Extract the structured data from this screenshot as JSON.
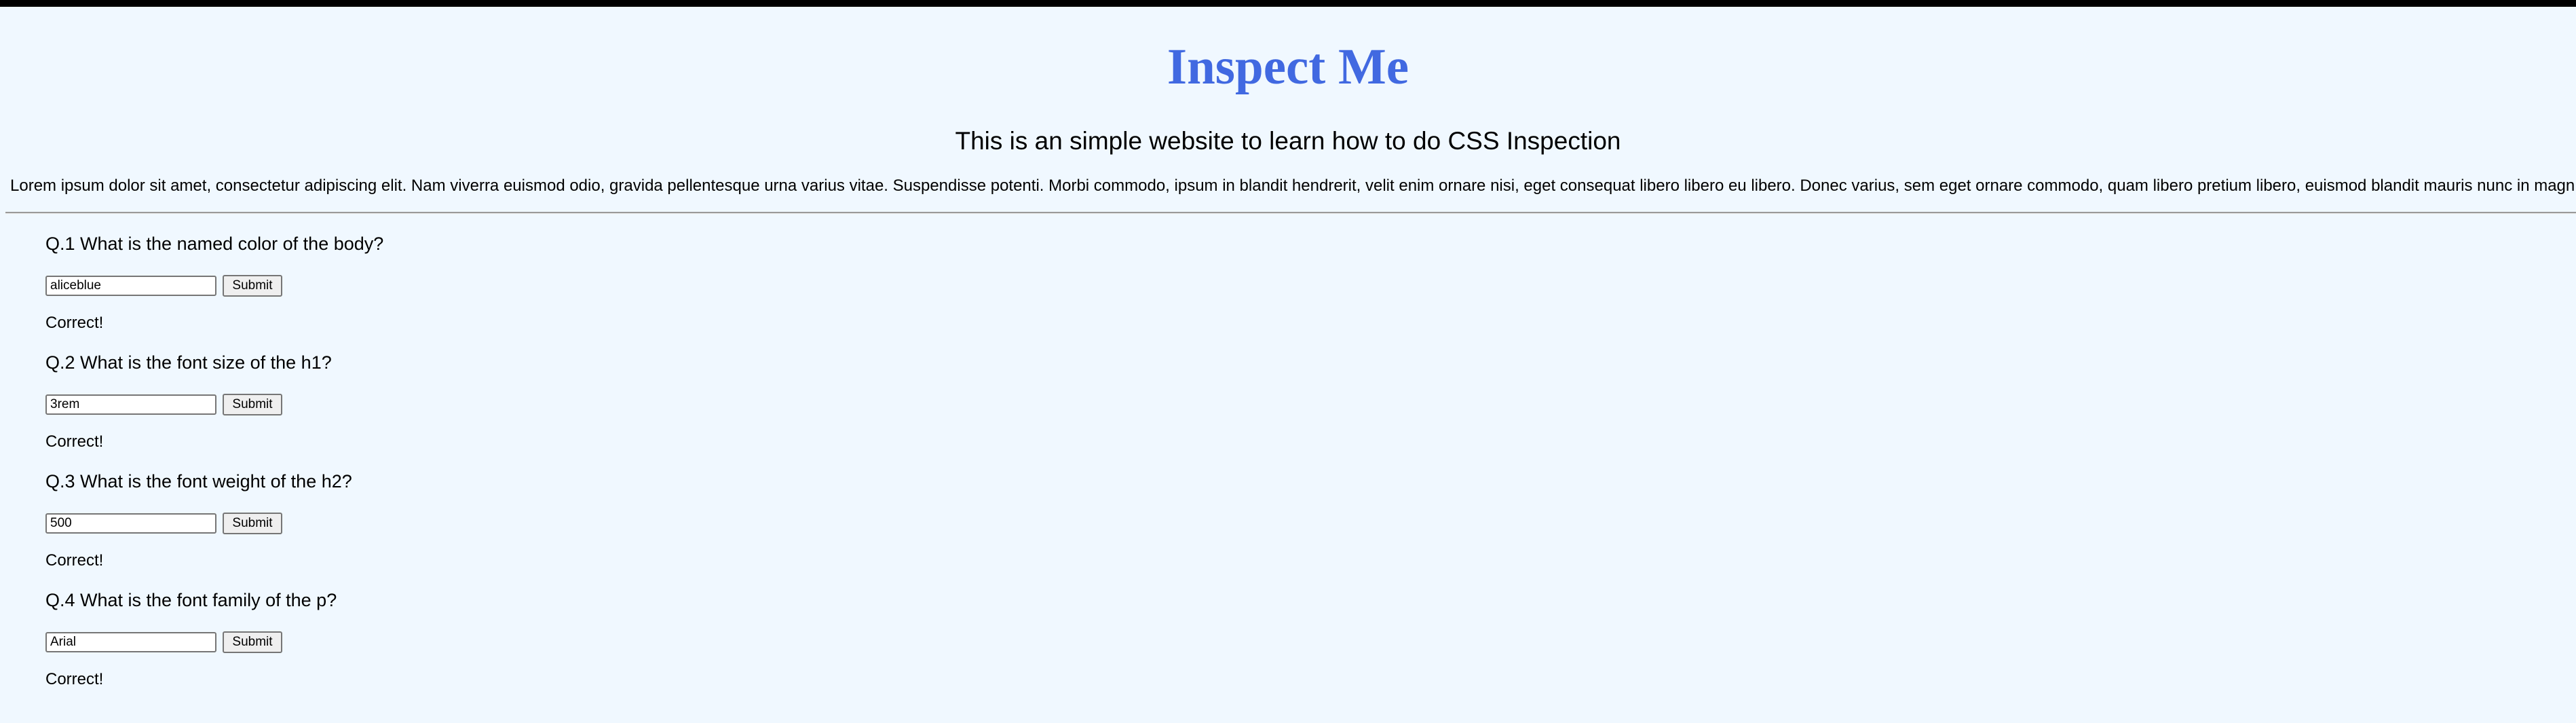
{
  "page": {
    "title": "Inspect Me",
    "subtitle": "This is an simple website to learn how to do CSS Inspection",
    "intro": "Lorem ipsum dolor sit amet, consectetur adipiscing elit. Nam viverra euismod odio, gravida pellentesque urna varius vitae. Suspendisse potenti. Morbi commodo, ipsum in blandit hendrerit, velit enim ornare nisi, eget consequat libero libero eu libero. Donec varius, sem eget ornare commodo, quam libero pretium libero, euismod blandit mauris nunc in magn"
  },
  "quiz": {
    "submit_label": "Submit",
    "questions": [
      {
        "question": "Q.1 What is the named color of the body?",
        "answer": "aliceblue",
        "result": "Correct!"
      },
      {
        "question": "Q.2 What is the font size of the h1?",
        "answer": "3rem",
        "result": "Correct!"
      },
      {
        "question": "Q.3 What is the font weight of the h2?",
        "answer": "500",
        "result": "Correct!"
      },
      {
        "question": "Q.4 What is the font family of the p?",
        "answer": "Arial",
        "result": "Correct!"
      }
    ]
  },
  "colors": {
    "background": "#f0f8ff",
    "title": "#4169e1"
  }
}
